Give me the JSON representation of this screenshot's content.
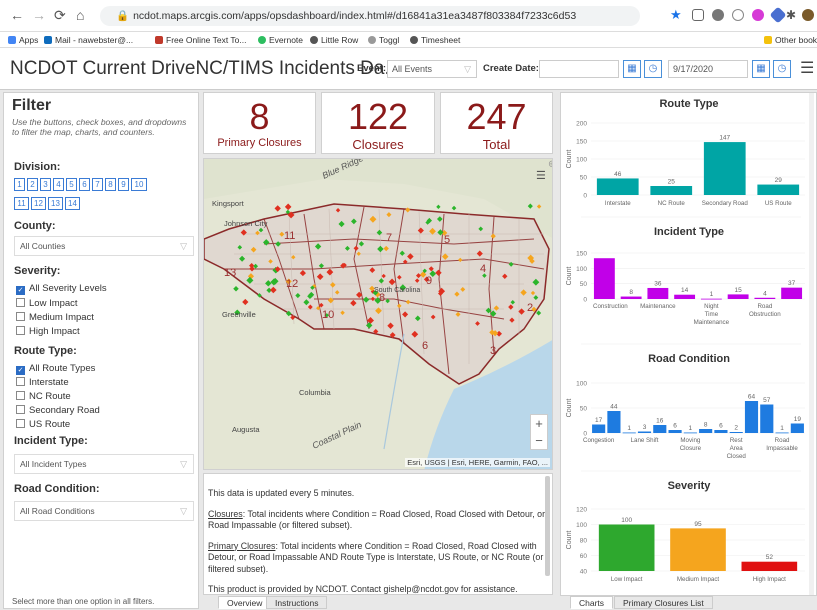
{
  "browser": {
    "url": "ncdot.maps.arcgis.com/apps/opsdashboard/index.html#/d16841a31ea3487f803384f7233c6d53",
    "bookmarks": [
      "Apps",
      "Mail - nawebster@...",
      "Free Online Text To...",
      "Evernote",
      "Little Row",
      "Toggl",
      "Timesheet",
      "Other bookmar"
    ]
  },
  "header": {
    "title": "NCDOT Current DriveNC/TIMS Incidents Da...",
    "event_label": "Event:",
    "event_value": "All Events",
    "create_date_label": "Create Date:",
    "date_value": "9/17/2020"
  },
  "filter": {
    "heading": "Filter",
    "note": "Use the buttons, check boxes, and dropdowns to filter the map, charts, and counters.",
    "division_label": "Division:",
    "divisions": [
      "1",
      "2",
      "3",
      "4",
      "5",
      "6",
      "7",
      "8",
      "9",
      "10",
      "11",
      "12",
      "13",
      "14"
    ],
    "county_label": "County:",
    "county_value": "All Counties",
    "severity_label": "Severity:",
    "severity_options": [
      "All Severity Levels",
      "Low Impact",
      "Medium Impact",
      "High Impact"
    ],
    "route_type_label": "Route Type:",
    "route_type_options": [
      "All Route Types",
      "Interstate",
      "NC Route",
      "Secondary Road",
      "US Route"
    ],
    "incident_type_label": "Incident Type:",
    "incident_type_value": "All Incident Types",
    "road_condition_label": "Road Condition:",
    "road_condition_value": "All Road Conditions",
    "footer": "Select more than one option in all filters."
  },
  "counters": {
    "primary": {
      "value": "8",
      "label": "Primary Closures"
    },
    "closures": {
      "value": "122",
      "label": "Closures"
    },
    "total": {
      "value": "247",
      "label": "Total"
    }
  },
  "map": {
    "attribution": "Esri, USGS | Esri, HERE, Garmin, FAO, ...",
    "places": [
      "Kingsport",
      "Johnson City",
      "Greenville",
      "Columbia",
      "Augusta",
      "Blue Ridge",
      "Coastal Plain",
      "South Carolina"
    ],
    "division_numbers": [
      "11",
      "13",
      "12",
      "10",
      "7",
      "5",
      "8",
      "6",
      "3",
      "2",
      "4",
      "9"
    ],
    "zoom_in": "+",
    "zoom_out": "−"
  },
  "info": {
    "update": "This data is updated every 5 minutes.",
    "closures_term": "Closures",
    "closures_def": ":  Total incidents where Condition = Road Closed, Road Closed with Detour, or Road Impassable (or filtered subset).",
    "primary_term": "Primary Closures",
    "primary_def": ":  Total incidents where Condition = Road Closed, Road Closed with Detour, or Road Impassable AND Route Type is Interstate, US Route, or NC Route (or filtered subset).",
    "provided": "This product is provided by NCDOT.  Contact gishelp@ncdot.gov for assistance."
  },
  "tabs": {
    "left": [
      "Overview",
      "Instructions"
    ],
    "right": [
      "Charts",
      "Primary Closures List"
    ]
  },
  "colors": {
    "counter_red": "#8b1a1a",
    "route_teal": "#00a5a5",
    "incident_purple": "#c100e8",
    "condition_blue": "#1e7be0"
  },
  "chart_data": [
    {
      "type": "bar",
      "title": "Route Type",
      "ylabel": "Count",
      "categories": [
        "Interstate",
        "NC Route",
        "Secondary Road",
        "US Route"
      ],
      "values": [
        46,
        25,
        147,
        29
      ],
      "ylim": [
        0,
        200
      ],
      "yticks": [
        0,
        50,
        100,
        150,
        200
      ],
      "color": "#00a5a5"
    },
    {
      "type": "bar",
      "title": "Incident Type",
      "ylabel": "Count",
      "categories": [
        "Construction",
        "",
        "Maintenance",
        "",
        "Night Time Maintenance",
        "",
        "Road Obstruction",
        "",
        ""
      ],
      "values": [
        133,
        8,
        36,
        14,
        1,
        15,
        4,
        37
      ],
      "ylim": [
        0,
        150
      ],
      "yticks": [
        0,
        50,
        100,
        150
      ],
      "labels_shown": [
        "",
        "8",
        "36",
        "14",
        "1",
        "15",
        "4",
        "37"
      ],
      "xlabels": [
        {
          "text": "Construction",
          "at": 0
        },
        {
          "text": "Maintenance",
          "at": 2
        },
        {
          "text": "Night Time Maintenance",
          "at": 4
        },
        {
          "text": "Road Obstruction",
          "at": 6
        }
      ],
      "color": "#c100e8"
    },
    {
      "type": "bar",
      "title": "Road Condition",
      "ylabel": "Count",
      "values": [
        17,
        44,
        1,
        3,
        16,
        6,
        1,
        8,
        6,
        2,
        64,
        57,
        1,
        19
      ],
      "labels_shown": [
        "17",
        "44",
        "1",
        "3",
        "16",
        "6",
        "1",
        "8",
        "6",
        "2",
        "64",
        "57",
        "1",
        "19"
      ],
      "ylim": [
        0,
        100
      ],
      "yticks": [
        0,
        50,
        100
      ],
      "xlabels": [
        {
          "text": "Congestion",
          "at": 0
        },
        {
          "text": "Lane Shift",
          "at": 3
        },
        {
          "text": "Moving Closure",
          "at": 6
        },
        {
          "text": "Rest Area Closed",
          "at": 9
        },
        {
          "text": "Road Impassable",
          "at": 12
        }
      ],
      "color": "#1e7be0"
    },
    {
      "type": "bar",
      "title": "Severity",
      "ylabel": "Count",
      "categories": [
        "Low Impact",
        "Medium Impact",
        "High Impact"
      ],
      "values": [
        100,
        95,
        52
      ],
      "ylim": [
        40,
        120
      ],
      "yticks": [
        40,
        60,
        80,
        100,
        120
      ],
      "colors": [
        "#2ea82e",
        "#f5a51e",
        "#e01010"
      ]
    }
  ]
}
